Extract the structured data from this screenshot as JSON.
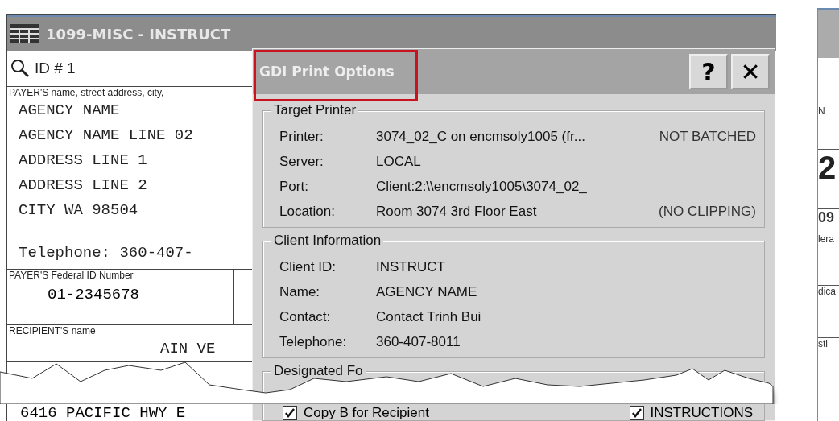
{
  "form_window": {
    "title": "1099-MISC - INSTRUCT",
    "record_id": "ID # 1",
    "payer": {
      "label": "PAYER'S name, street address, city,",
      "lines": [
        "AGENCY NAME",
        "AGENCY NAME LINE 02",
        "ADDRESS LINE 1",
        "ADDRESS LINE 2",
        "CITY WA 98504"
      ],
      "telephone": "Telephone: 360-407-"
    },
    "federal_id": {
      "label": "PAYER'S Federal ID Number",
      "value": "01-2345678"
    },
    "recipient": {
      "label": "RECIPIENT'S name",
      "name_fragment": "AIN VE",
      "address": "6416 PACIFIC HWY E"
    }
  },
  "dialog": {
    "title": "GDI Print Options",
    "title_highlighted": true,
    "buttons": [
      "?",
      "✕"
    ],
    "groups": [
      {
        "title": "Target Printer",
        "rows": [
          {
            "label": "Printer:",
            "value": "3074_02_C on encmsoly1005 (fr...",
            "note": "NOT BATCHED"
          },
          {
            "label": "Server:",
            "value": "LOCAL"
          },
          {
            "label": "Port:",
            "value": "Client:2:\\\\encmsoly1005\\3074_02_"
          },
          {
            "label": "Location:",
            "value": "Room 3074 3rd Floor East",
            "note": "(NO CLIPPING)"
          }
        ]
      },
      {
        "title": "Client Information",
        "rows": [
          {
            "label": "Client ID:",
            "value": "INSTRUCT"
          },
          {
            "label": "Name:",
            "value": "AGENCY NAME"
          },
          {
            "label": "Contact:",
            "value": "Contact Trinh Bui"
          },
          {
            "label": "Telephone:",
            "value": "360-407-8011"
          }
        ]
      },
      {
        "title": "Designated Fo"
      }
    ],
    "checkboxes": [
      {
        "label": "Copy B for Recipient",
        "checked": true
      },
      {
        "label": "INSTRUCTIONS",
        "checked": true
      }
    ]
  },
  "background_window": {
    "fragments": [
      "N",
      "2",
      "09",
      "lera",
      "dica",
      "sti"
    ]
  }
}
